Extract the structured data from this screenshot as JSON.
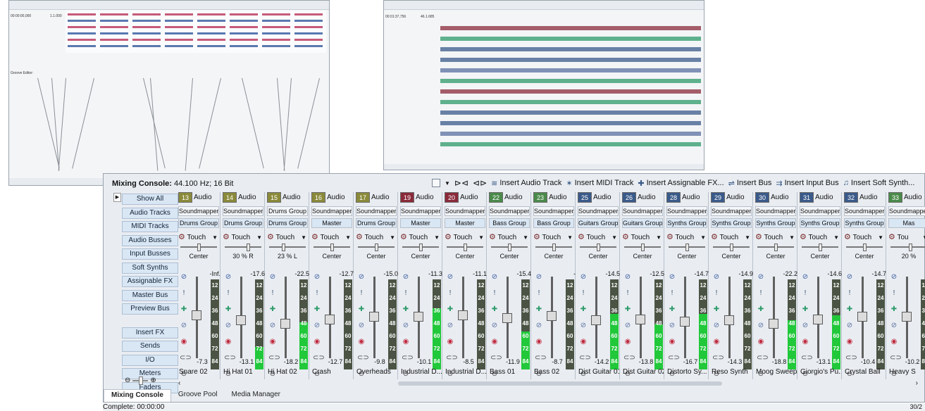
{
  "console": {
    "title_label": "Mixing Console:",
    "format": "44.100 Hz; 16 Bit",
    "toolbar": {
      "insert_audio": "Insert Audio Track",
      "insert_midi": "Insert MIDI Track",
      "insert_assignable_fx": "Insert Assignable FX...",
      "insert_bus": "Insert Bus",
      "insert_input_bus": "Insert Input Bus",
      "insert_soft_synth": "Insert Soft Synth..."
    },
    "side_buttons": [
      "Show All",
      "Audio Tracks",
      "MIDI Tracks",
      "Audio Busses",
      "Input Busses",
      "Soft Synths",
      "Assignable FX",
      "Master Bus",
      "Preview Bus"
    ],
    "side_buttons_2": [
      "Insert FX",
      "Sends",
      "I/O",
      "Meters",
      "Faders"
    ],
    "meter_scale": [
      "12",
      "24",
      "36",
      "48",
      "60",
      "72",
      "84"
    ],
    "strips": [
      {
        "num": "13",
        "kind": "Audio",
        "color": "#8a8a3a",
        "out": "Soundmapper",
        "group": "Drums Group",
        "mode": "Touch",
        "pan": "Center",
        "pan_pos": 0.5,
        "peak": "-Inf.",
        "gain": "-7.3",
        "fader": 0.52,
        "level": 0.0,
        "name": "Snare 02"
      },
      {
        "num": "14",
        "kind": "Audio",
        "color": "#8a8a3a",
        "out": "Soundmapper",
        "group": "Drums Group",
        "mode": "Touch",
        "pan": "30 % R",
        "pan_pos": 0.65,
        "peak": "-17.6",
        "gain": "-13.1",
        "fader": 0.45,
        "level": 0.25,
        "name": "Hi Hat 01"
      },
      {
        "num": "15",
        "kind": "Audio",
        "color": "#8a8a3a",
        "out": "Drums Group",
        "group": "Drums Group",
        "mode": "Touch",
        "pan": "23 % L",
        "pan_pos": 0.38,
        "peak": "-22.5",
        "gain": "-18.2",
        "fader": 0.4,
        "level": 0.52,
        "name": "Hi Hat 02"
      },
      {
        "num": "16",
        "kind": "Audio",
        "color": "#8a8a3a",
        "out": "Soundmapper",
        "group": "Master",
        "mode": "Touch",
        "pan": "Center",
        "pan_pos": 0.5,
        "peak": "-12.7",
        "gain": "-12.7",
        "fader": 0.46,
        "level": 0.0,
        "name": "Crash"
      },
      {
        "num": "17",
        "kind": "Audio",
        "color": "#8a8a3a",
        "out": "Soundmapper",
        "group": "Drums Group",
        "mode": "Touch",
        "pan": "Center",
        "pan_pos": 0.5,
        "peak": "-15.0",
        "gain": "-9.8",
        "fader": 0.5,
        "level": 0.0,
        "name": "Overheads"
      },
      {
        "num": "19",
        "kind": "Audio",
        "color": "#8a2a3a",
        "out": "Soundmapper",
        "group": "Master",
        "mode": "Touch",
        "pan": "Center",
        "pan_pos": 0.5,
        "peak": "-11.3",
        "gain": "-10.1",
        "fader": 0.5,
        "level": 0.68,
        "name": "Industrial D..."
      },
      {
        "num": "20",
        "kind": "Audio",
        "color": "#8a2a3a",
        "out": "Soundmapper",
        "group": "Master",
        "mode": "Touch",
        "pan": "Center",
        "pan_pos": 0.5,
        "peak": "-11.1",
        "gain": "-8.5",
        "fader": 0.52,
        "level": 0.0,
        "name": "Industrial D..."
      },
      {
        "num": "22",
        "kind": "Audio",
        "color": "#4a8a4a",
        "out": "Soundmapper",
        "group": "Bass Group",
        "mode": "Touch",
        "pan": "Center",
        "pan_pos": 0.5,
        "peak": "-15.4",
        "gain": "-11.9",
        "fader": 0.48,
        "level": 0.42,
        "name": "Bass 01"
      },
      {
        "num": "23",
        "kind": "Audio",
        "color": "#4a8a4a",
        "out": "Soundmapper",
        "group": "Bass Group",
        "mode": "Touch",
        "pan": "Center",
        "pan_pos": 0.5,
        "peak": "-",
        "gain": "-8.7",
        "fader": 0.51,
        "level": 0.0,
        "name": "Bass 02"
      },
      {
        "num": "25",
        "kind": "Audio",
        "color": "#3a5a8a",
        "out": "Soundmapper",
        "group": "Guitars Group",
        "mode": "Touch",
        "pan": "Center",
        "pan_pos": 0.5,
        "peak": "-14.5",
        "gain": "-14.2",
        "fader": 0.45,
        "level": 0.62,
        "name": "Dist Guitar 01"
      },
      {
        "num": "26",
        "kind": "Audio",
        "color": "#3a5a8a",
        "out": "Soundmapper",
        "group": "Guitars Group",
        "mode": "Touch",
        "pan": "Center",
        "pan_pos": 0.5,
        "peak": "-12.5",
        "gain": "-13.8",
        "fader": 0.46,
        "level": 0.5,
        "name": "Dist Guitar 02"
      },
      {
        "num": "28",
        "kind": "Audio",
        "color": "#3a5a8a",
        "out": "Soundmapper",
        "group": "Synths Group",
        "mode": "Touch",
        "pan": "Center",
        "pan_pos": 0.5,
        "peak": "-14.7",
        "gain": "-16.7",
        "fader": 0.43,
        "level": 0.62,
        "name": "Distorto Sy..."
      },
      {
        "num": "29",
        "kind": "Audio",
        "color": "#3a5a8a",
        "out": "Soundmapper",
        "group": "Synths Group",
        "mode": "Touch",
        "pan": "Center",
        "pan_pos": 0.5,
        "peak": "-14.9",
        "gain": "-14.3",
        "fader": 0.45,
        "level": 0.0,
        "name": "Reso Synth"
      },
      {
        "num": "30",
        "kind": "Audio",
        "color": "#3a5a8a",
        "out": "Soundmapper",
        "group": "Synths Group",
        "mode": "Touch",
        "pan": "Center",
        "pan_pos": 0.5,
        "peak": "-22.2",
        "gain": "-18.8",
        "fader": 0.4,
        "level": 0.55,
        "name": "Moog Sweep"
      },
      {
        "num": "31",
        "kind": "Audio",
        "color": "#3a5a8a",
        "out": "Soundmapper",
        "group": "Synths Group",
        "mode": "Touch",
        "pan": "Center",
        "pan_pos": 0.5,
        "peak": "-14.6",
        "gain": "-13.1",
        "fader": 0.46,
        "level": 0.6,
        "name": "Giorgio's Pu..."
      },
      {
        "num": "32",
        "kind": "Audio",
        "color": "#3a5a8a",
        "out": "Soundmapper",
        "group": "Synths Group",
        "mode": "Touch",
        "pan": "Center",
        "pan_pos": 0.5,
        "peak": "-14.7",
        "gain": "-10.4",
        "fader": 0.5,
        "level": 0.0,
        "name": "Crystal Ball"
      },
      {
        "num": "33",
        "kind": "Audio",
        "color": "#4a8a4a",
        "out": "Soundmapper",
        "group": "Mas",
        "mode": "Tou",
        "pan": "20 %",
        "pan_pos": 0.55,
        "peak": "",
        "gain": "-10.2",
        "fader": 0.5,
        "level": 0.0,
        "name": "Heavy S"
      }
    ],
    "tabs": [
      "Mixing Console",
      "Groove Pool",
      "Media Manager"
    ]
  },
  "status": {
    "text": "Complete: 00:00:00",
    "right": "30/2"
  },
  "thumb_left": {
    "time": "00:00:00,000",
    "tempo": "1.1.000",
    "title": "Groove Editor:"
  },
  "thumb_right": {
    "time": "00:01:37,756",
    "tempo": "46.1.685"
  }
}
